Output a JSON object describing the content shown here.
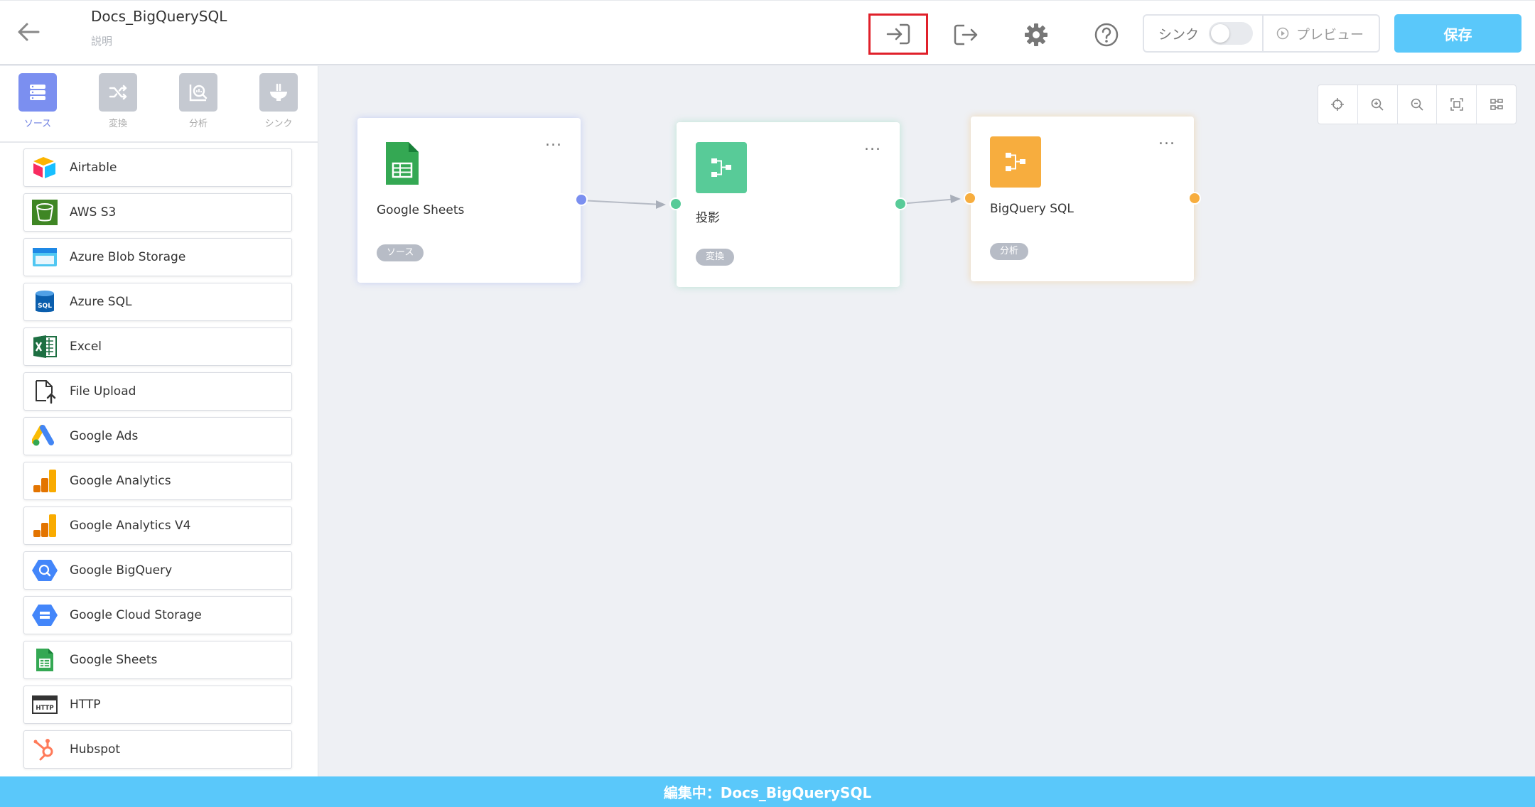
{
  "header": {
    "title": "Docs_BigQuerySQL",
    "description": "説明",
    "sync_label": "シンク",
    "preview_label": "プレビュー",
    "save_label": "保存"
  },
  "sidebar": {
    "tabs": [
      {
        "label": "ソース",
        "icon": "database-icon",
        "active": true
      },
      {
        "label": "変換",
        "icon": "shuffle-icon",
        "active": false
      },
      {
        "label": "分析",
        "icon": "analysis-icon",
        "active": false
      },
      {
        "label": "シンク",
        "icon": "sink-icon",
        "active": false
      }
    ],
    "connectors": [
      {
        "name": "Airtable",
        "icon": "airtable-icon"
      },
      {
        "name": "AWS S3",
        "icon": "aws-s3-icon"
      },
      {
        "name": "Azure Blob Storage",
        "icon": "azure-blob-icon"
      },
      {
        "name": "Azure SQL",
        "icon": "azure-sql-icon"
      },
      {
        "name": "Excel",
        "icon": "excel-icon"
      },
      {
        "name": "File Upload",
        "icon": "file-upload-icon"
      },
      {
        "name": "Google Ads",
        "icon": "google-ads-icon"
      },
      {
        "name": "Google Analytics",
        "icon": "google-analytics-icon"
      },
      {
        "name": "Google Analytics V4",
        "icon": "google-analytics-icon"
      },
      {
        "name": "Google BigQuery",
        "icon": "bigquery-icon"
      },
      {
        "name": "Google Cloud Storage",
        "icon": "gcs-icon"
      },
      {
        "name": "Google Sheets",
        "icon": "sheets-icon"
      },
      {
        "name": "HTTP",
        "icon": "http-icon"
      },
      {
        "name": "Hubspot",
        "icon": "hubspot-icon"
      }
    ]
  },
  "nodes": [
    {
      "title": "Google Sheets",
      "badge": "ソース",
      "icon": "sheets-icon",
      "menu": "..."
    },
    {
      "title": "投影",
      "badge": "変換",
      "icon": "transform-icon",
      "menu": "..."
    },
    {
      "title": "BigQuery SQL",
      "badge": "分析",
      "icon": "analysis-flow-icon",
      "menu": "..."
    }
  ],
  "colors": {
    "accent": "#5ac8fa",
    "source": "#7b8ff0",
    "transform": "#58cb98",
    "analysis": "#f7ad3e",
    "highlight": "#e0202a"
  },
  "footer": {
    "status": "編集中：Docs_BigQuerySQL"
  }
}
